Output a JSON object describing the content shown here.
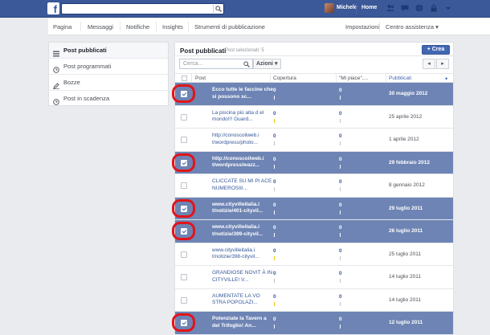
{
  "topbar": {
    "logo": "f",
    "search_placeholder": "",
    "user_name": "Michele",
    "home_label": "Home",
    "icons": [
      "friends-icon",
      "messages-icon",
      "globe-icon",
      "lock-icon",
      "dropdown-icon"
    ],
    "color": "#3b5998"
  },
  "pagenav": {
    "items": [
      "Pagina",
      "Messaggi",
      "Notifiche",
      "Insights",
      "Strumenti di pubblicazione"
    ],
    "right_items": [
      "Impostazioni",
      "Centro assistenza ▾"
    ]
  },
  "sidebar": {
    "items": [
      {
        "label": "Post pubblicati",
        "icon": "list-icon",
        "active": true
      },
      {
        "label": "Post programmati",
        "icon": "clock-icon",
        "active": false
      },
      {
        "label": "Bozze",
        "icon": "pencil-icon",
        "active": false
      },
      {
        "label": "Post in scadenza",
        "icon": "clock-icon",
        "active": false
      }
    ]
  },
  "main": {
    "title": "Post pubblicati",
    "subtitle": "Post selezionati: 5",
    "create_label": "+ Crea",
    "search_placeholder": "Cerca...",
    "actions_label": "Azioni ▾",
    "pager_prev": "◂",
    "pager_next": "▸",
    "columns": [
      "Post",
      "Copertura",
      "\"Mi piace\",...",
      "Pubblicati"
    ],
    "sorted_column": "Pubblicati",
    "selected_color": "#6d84b4",
    "highlight_color": "#e0151b",
    "rows": [
      {
        "post": "Ecco tutte le faccine che si possono sc...",
        "reach": "0",
        "likes": "0",
        "date": "30 maggio 2012",
        "selected": true,
        "bar": "grey"
      },
      {
        "post": "La piscina più alta d el mondo!!! Guard...",
        "reach": "0",
        "likes": "0",
        "date": "25 aprile 2012",
        "selected": false,
        "bar": "yellow"
      },
      {
        "post": "http://conoscoilweb.i t/wordpress/photo...",
        "reach": "0",
        "likes": "0",
        "date": "1 aprile 2012",
        "selected": false,
        "bar": "grey"
      },
      {
        "post": "http://conoscoilweb.i t/wordpress/wazz...",
        "reach": "0",
        "likes": "0",
        "date": "29 febbraio 2012",
        "selected": true,
        "bar": "grey"
      },
      {
        "post": "CLICCATE SU MI PI ACE NUMEROSIII...",
        "reach": "0",
        "likes": "0",
        "date": "8 gennaio 2012",
        "selected": false,
        "bar": "grey"
      },
      {
        "post": "www.cityvilleitalia.i t/notizie/401-cityvil...",
        "reach": "0",
        "likes": "0",
        "date": "29 luglio 2011",
        "selected": true,
        "bar": "grey"
      },
      {
        "post": "www.cityvilleitalia.i t/notizie/399-cityvil...",
        "reach": "0",
        "likes": "0",
        "date": "26 luglio 2011",
        "selected": true,
        "bar": "grey"
      },
      {
        "post": "www.cityvilleitalia.i t/notizie/398-cityvil...",
        "reach": "0",
        "likes": "0",
        "date": "25 luglio 2011",
        "selected": false,
        "bar": "yellow"
      },
      {
        "post": "GRANDIOSE NOVIT À IN CITYVILLE! V...",
        "reach": "0",
        "likes": "0",
        "date": "14 luglio 2011",
        "selected": false,
        "bar": "grey"
      },
      {
        "post": "AUMENTATE LA VO STRA POPOLAZI...",
        "reach": "0",
        "likes": "0",
        "date": "14 luglio 2011",
        "selected": false,
        "bar": "yellow"
      },
      {
        "post": "Potenziate la Tavern a del Trifoglio! An...",
        "reach": "0",
        "likes": "0",
        "date": "12 luglio 2011",
        "selected": true,
        "bar": "grey"
      }
    ]
  }
}
